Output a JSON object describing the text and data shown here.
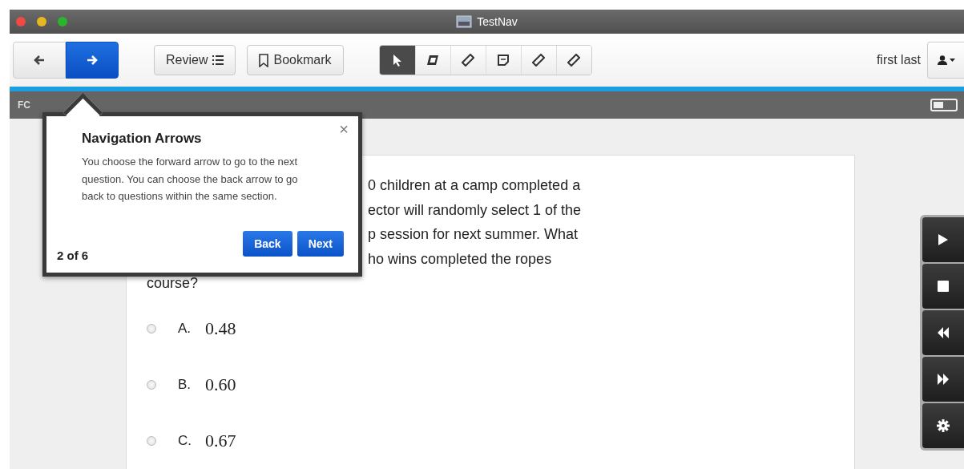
{
  "window": {
    "title": "TestNav"
  },
  "nav": [
    {
      "kind": "back",
      "selected": false
    },
    {
      "kind": "forward",
      "selected": true
    }
  ],
  "toolbar_buttons": [
    {
      "kind": "review",
      "label": "Review"
    },
    {
      "kind": "bookmark",
      "label": "Bookmark"
    }
  ],
  "tools": [
    {
      "kind": "pointer",
      "selected": true
    },
    {
      "kind": "eraser",
      "selected": false
    },
    {
      "kind": "pencil",
      "selected": false
    },
    {
      "kind": "note",
      "selected": false
    },
    {
      "kind": "pencil",
      "selected": false
    },
    {
      "kind": "pencil",
      "selected": false
    }
  ],
  "user": {
    "name": "first last"
  },
  "breadcrumb": {
    "text": "FC"
  },
  "question": {
    "lines": [
      {
        "kind": "partial",
        "text": "0 children at a camp completed a"
      },
      {
        "kind": "partial",
        "text": "ector will randomly select 1 of the"
      },
      {
        "kind": "partial",
        "text": "p session for next summer. What"
      },
      {
        "kind": "partial",
        "text": "ho wins completed the ropes"
      },
      {
        "kind": "full",
        "text": "course?"
      }
    ],
    "choices": [
      {
        "letter": "A.",
        "value": "0.48",
        "selected": false
      },
      {
        "letter": "B.",
        "value": "0.60",
        "selected": false
      },
      {
        "letter": "C.",
        "value": "0.67",
        "selected": false
      }
    ]
  },
  "media_controls": [
    {
      "kind": "play"
    },
    {
      "kind": "stop"
    },
    {
      "kind": "rewind"
    },
    {
      "kind": "fast-forward"
    },
    {
      "kind": "settings"
    }
  ],
  "popover": {
    "title": "Navigation Arrows",
    "close": "×",
    "body": "You choose the forward arrow to go to the next question. You can choose the back arrow to go back to questions within the same section.",
    "step": "2 of 6",
    "buttons": [
      "Back",
      "Next"
    ]
  }
}
